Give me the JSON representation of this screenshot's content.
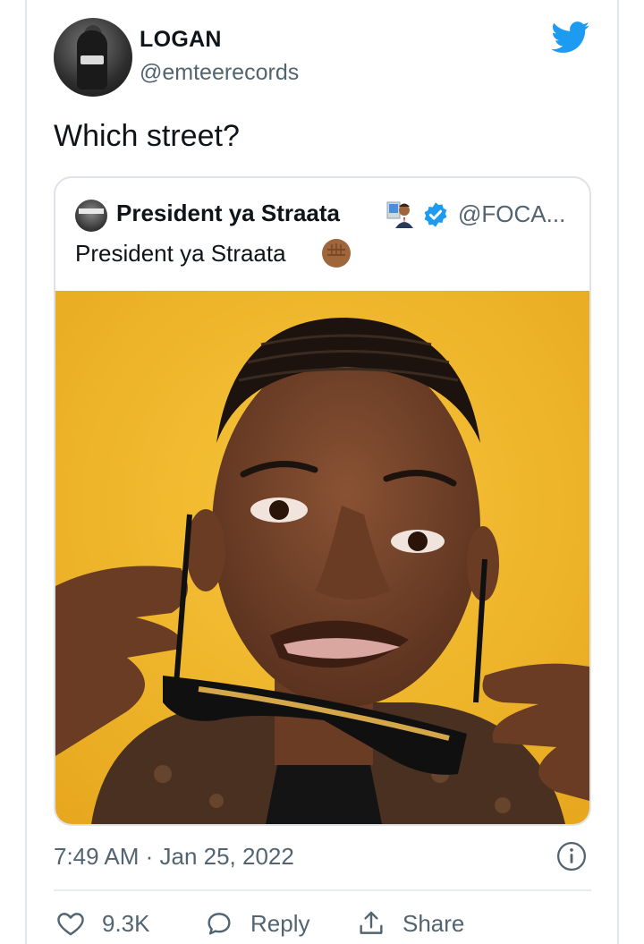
{
  "tweet": {
    "author_name": "LOGAN",
    "author_handle": "@emteerecords",
    "text": "Which street?",
    "timestamp": "7:49 AM · Jan 25, 2022"
  },
  "quoted_tweet": {
    "author_name": "President ya Straata",
    "author_handle": "@FOCA...",
    "text": "President ya Straata",
    "name_emoji": "man-technologist-emoji",
    "text_emoji": "raised-fist-emoji"
  },
  "actions": {
    "like_count": "9.3K",
    "reply_label": "Reply",
    "share_label": "Share"
  },
  "colors": {
    "brand_blue": "#1d9bf0",
    "muted_text": "#536471",
    "photo_background": "#f2b728"
  }
}
